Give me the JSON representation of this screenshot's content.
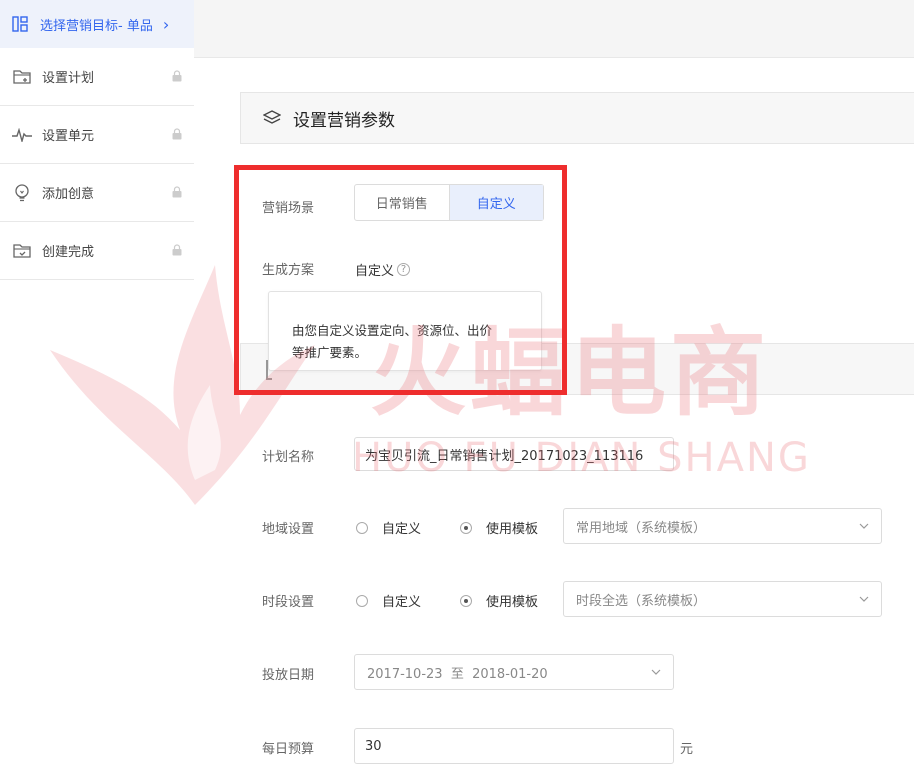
{
  "sidebar": {
    "top": {
      "label": "选择营销目标- 单品",
      "icon": "grid-icon",
      "chevron": "›"
    },
    "items": [
      {
        "label": "设置计划",
        "icon": "folder-plus-icon"
      },
      {
        "label": "设置单元",
        "icon": "pulse-icon"
      },
      {
        "label": "添加创意",
        "icon": "bulb-icon"
      },
      {
        "label": "创建完成",
        "icon": "folder-check-icon"
      }
    ]
  },
  "section": {
    "title": "设置营销参数",
    "icon": "layers-icon"
  },
  "scene": {
    "label": "营销场景",
    "options": [
      "日常销售",
      "自定义"
    ],
    "selected": "自定义"
  },
  "generate": {
    "label": "生成方案",
    "value": "自定义",
    "help": "?"
  },
  "tooltip": {
    "line1": "由您自定义设置定向、资源位、出价",
    "line2": "等推广要素。"
  },
  "plan_name": {
    "label": "计划名称",
    "value": "为宝贝引流_日常销售计划_20171023_113116"
  },
  "region": {
    "label": "地域设置",
    "opt_custom": "自定义",
    "opt_template": "使用模板",
    "select": "常用地域（系统模板）"
  },
  "time": {
    "label": "时段设置",
    "opt_custom": "自定义",
    "opt_template": "使用模板",
    "select": "时段全选（系统模板）"
  },
  "date": {
    "label": "投放日期",
    "start": "2017-10-23",
    "to": "至",
    "end": "2018-01-20"
  },
  "budget": {
    "label": "每日预算",
    "value": "30",
    "unit": "元"
  },
  "watermark": {
    "cn": "火蝠电商",
    "en": "HUO FU DIAN SHANG"
  },
  "colors": {
    "accent": "#3366ee",
    "highlight": "#ee2d2d",
    "watermark": "#e86e78"
  }
}
